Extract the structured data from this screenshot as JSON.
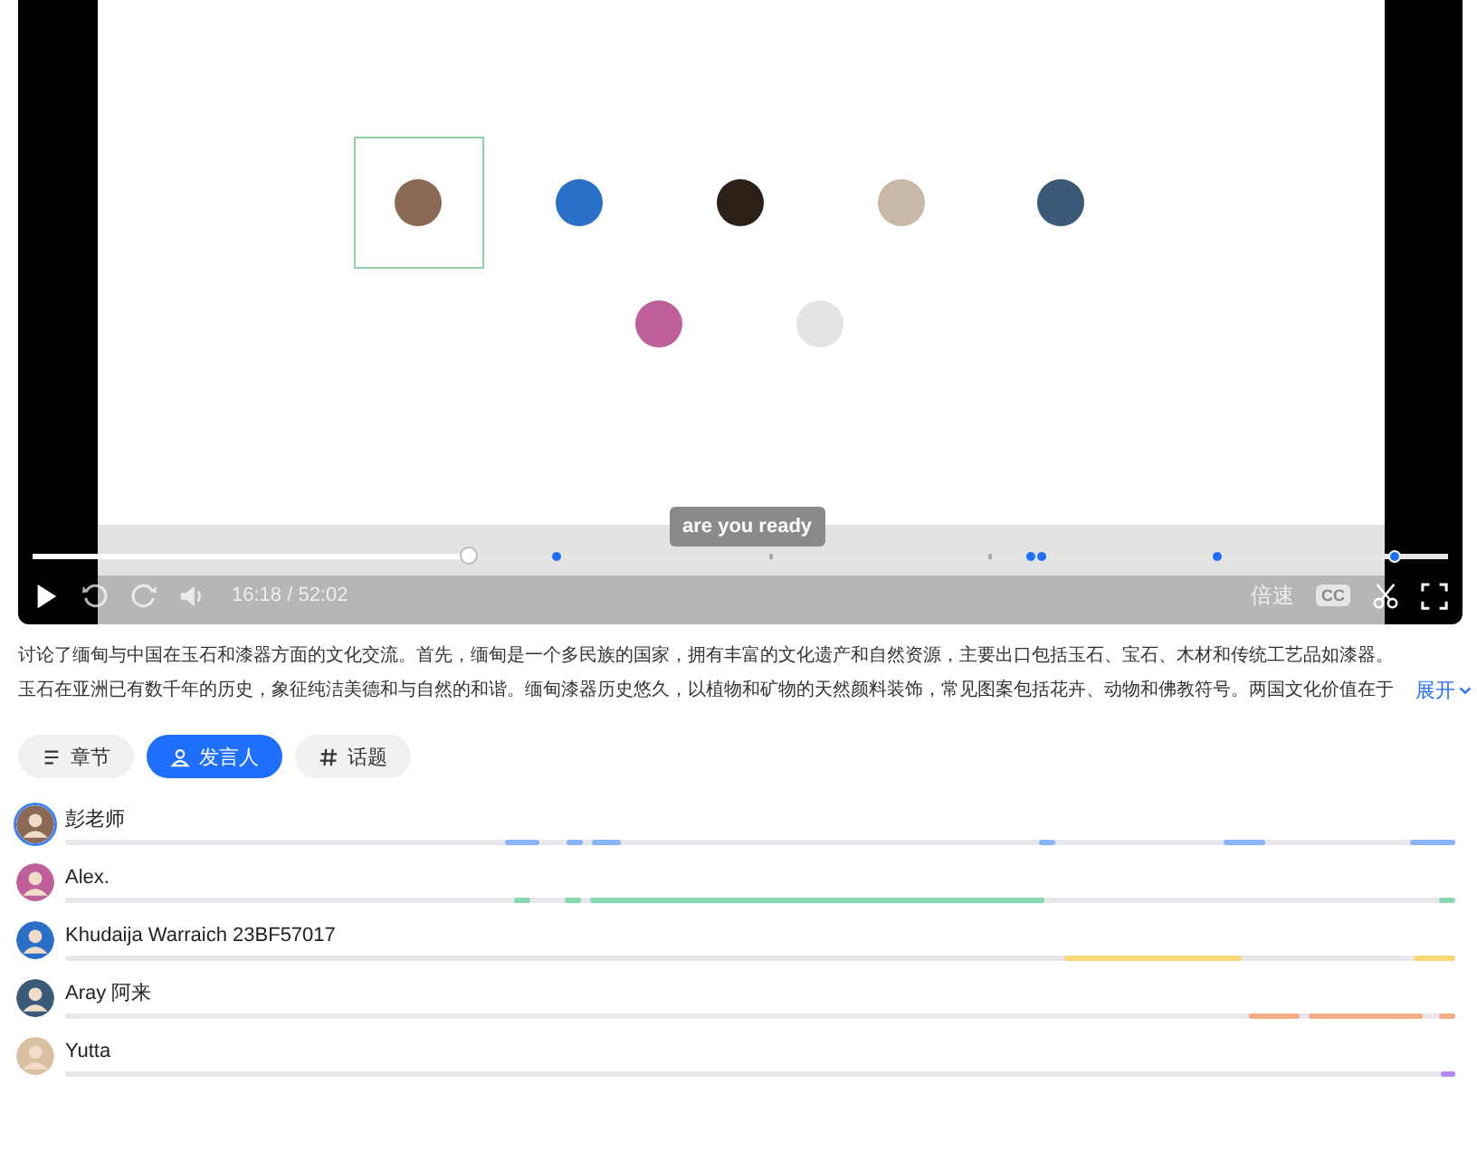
{
  "player": {
    "subtitle": "are you ready",
    "progress": {
      "level": 0.31
    },
    "time": "16:18 / 52:02",
    "speed": "倍速",
    "captions": "CC"
  },
  "summary": {
    "text": "讨论了缅甸与中国在玉石和漆器方面的文化交流。首先，缅甸是一个多民族的国家，拥有丰富的文化遗产和自然资源，主要出口包括玉石、宝石、木材和传统工艺品如漆器。玉石在亚洲已有数千年的历史，象征纯洁美德和与自然的和谐。缅甸漆器历史悠久，以植物和矿物的天然颜料装饰，常见图案包括花卉、动物和佛教符号。两国文化价值在于",
    "expand": "展开"
  },
  "tabs": [
    {
      "label": "章节",
      "selected": false
    },
    {
      "label": "发言人",
      "selected": true
    },
    {
      "label": "话题",
      "selected": false
    }
  ],
  "speakers": [
    {
      "name": "彭老师",
      "color": "#8ab4f8",
      "active": true
    },
    {
      "name": "Alex.",
      "color": "#86d9b0",
      "active": false
    },
    {
      "name": "Khudaija Warraich 23BF57017",
      "color": "#f9d877",
      "active": false
    },
    {
      "name": "Aray 阿来",
      "color": "#f5ad85",
      "active": false
    },
    {
      "name": "Yutta",
      "color": "#b48af7",
      "active": false
    }
  ]
}
